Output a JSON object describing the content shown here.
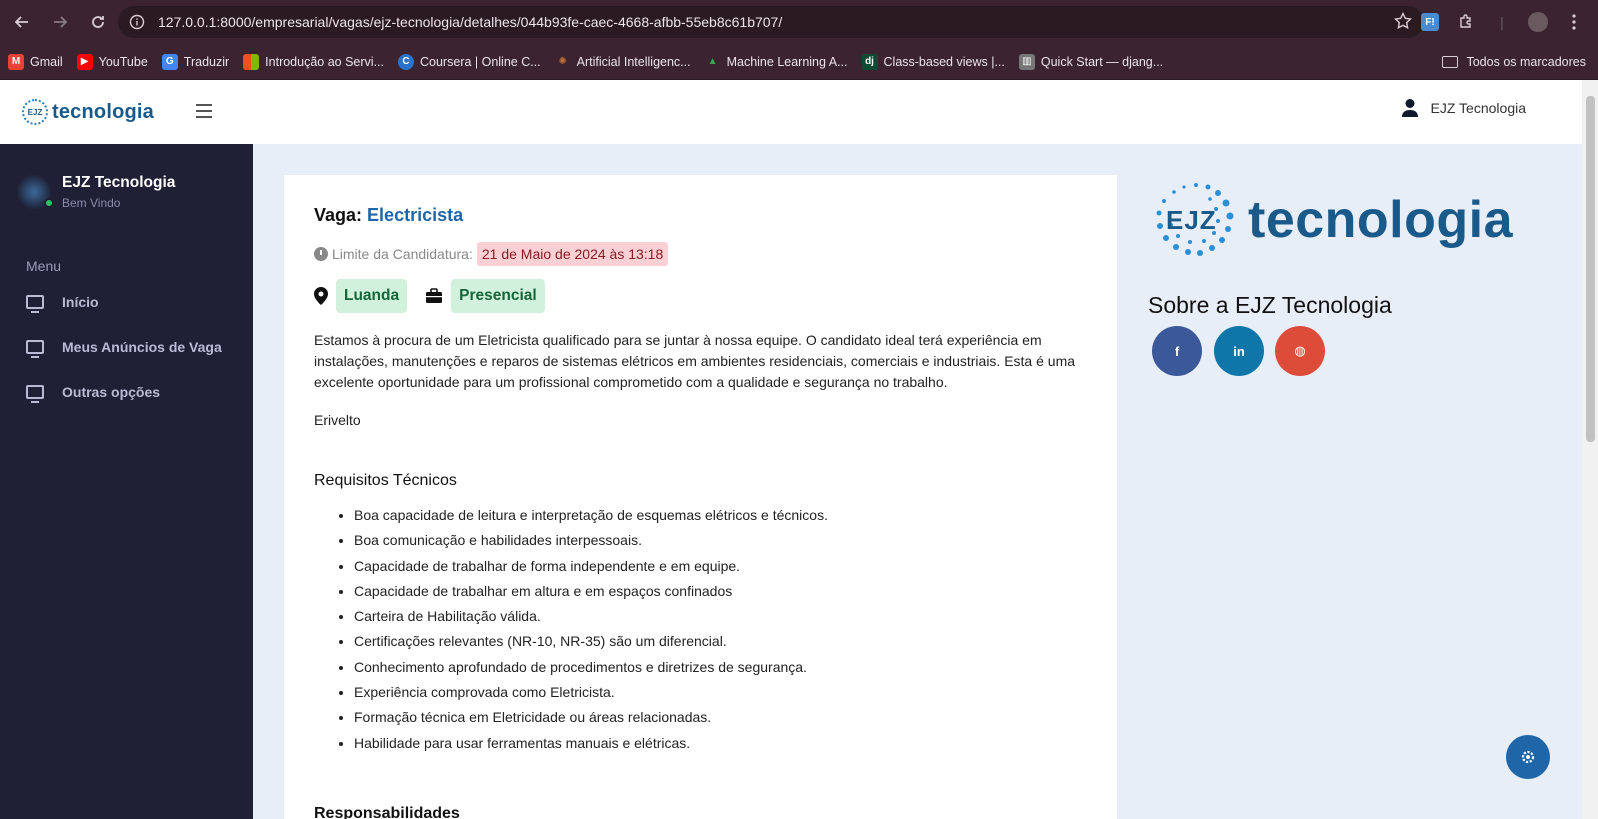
{
  "browser": {
    "url": "127.0.0.1:8000/empresarial/vagas/ejz-tecnologia/detalhes/044b93fe-caec-4668-afbb-55eb8c61b707/",
    "bookmarks": [
      {
        "label": "Gmail",
        "icon": "gmail-icon",
        "color": "#ea4335"
      },
      {
        "label": "YouTube",
        "icon": "youtube-icon",
        "color": "#ff0000"
      },
      {
        "label": "Traduzir",
        "icon": "translate-icon",
        "color": "#4285f4"
      },
      {
        "label": "Introdução ao Servi...",
        "icon": "microsoft-icon",
        "color": "#f25022"
      },
      {
        "label": "Coursera | Online C...",
        "icon": "coursera-icon",
        "color": "#2a73cc"
      },
      {
        "label": "Artificial Intelligenc...",
        "icon": "ai-icon",
        "color": "#c0703a"
      },
      {
        "label": "Machine Learning A...",
        "icon": "drive-icon",
        "color": "#34a853"
      },
      {
        "label": "Class-based views |...",
        "icon": "django-icon",
        "color": "#0c4b33"
      },
      {
        "label": "Quick Start — djang...",
        "icon": "docs-icon",
        "color": "#888888"
      }
    ],
    "all_bookmarks": "Todos os marcadores"
  },
  "header": {
    "logo_text": "tecnologia",
    "logo_mark": "EJZ",
    "user_name": "EJZ Tecnologia"
  },
  "sidebar": {
    "profile_name": "EJZ Tecnologia",
    "profile_sub": "Bem Vindo",
    "menu_label": "Menu",
    "items": [
      {
        "label": "Início"
      },
      {
        "label": "Meus Anúncios de Vaga"
      },
      {
        "label": "Outras opções"
      }
    ]
  },
  "job": {
    "title_prefix": "Vaga:",
    "title": "Electricista",
    "deadline_label": "Limite da Candidatura:",
    "deadline_value": "21 de Maio de 2024 às 13:18",
    "location": "Luanda",
    "work_mode": "Presencial",
    "description": "Estamos à procura de um Eletricista qualificado para se juntar à nossa equipe. O candidato ideal terá experiência em instalações, manutenções e reparos de sistemas elétricos em ambientes residenciais, comerciais e industriais. Esta é uma excelente oportunidade para um profissional comprometido com a qualidade e segurança no trabalho.",
    "signature": "Erivelto",
    "requirements_title": "Requisitos Técnicos",
    "requirements": [
      "Boa capacidade de leitura e interpretação de esquemas elétricos e técnicos.",
      "Boa comunicação e habilidades interpessoais.",
      "Capacidade de trabalhar de forma independente e em equipe.",
      "Capacidade de trabalhar em altura e em espaços confinados",
      "Carteira de Habilitação válida.",
      "Certificações relevantes (NR-10, NR-35) são um diferencial.",
      "Conhecimento aprofundado de procedimentos e diretrizes de segurança.",
      "Experiência comprovada como Eletricista.",
      "Formação técnica em Eletricidade ou áreas relacionadas.",
      "Habilidade para usar ferramentas manuais e elétricas."
    ],
    "responsibilities_title": "Responsabilidades"
  },
  "company": {
    "brand_mark": "EJZ",
    "brand_word": "tecnologia",
    "about_title": "Sobre a EJZ Tecnologia",
    "social": [
      {
        "name": "facebook",
        "glyph": "f",
        "color": "#3b5998"
      },
      {
        "name": "linkedin",
        "glyph": "in",
        "color": "#0e76a8"
      },
      {
        "name": "website",
        "glyph": "◍",
        "color": "#dd4b39"
      }
    ]
  }
}
